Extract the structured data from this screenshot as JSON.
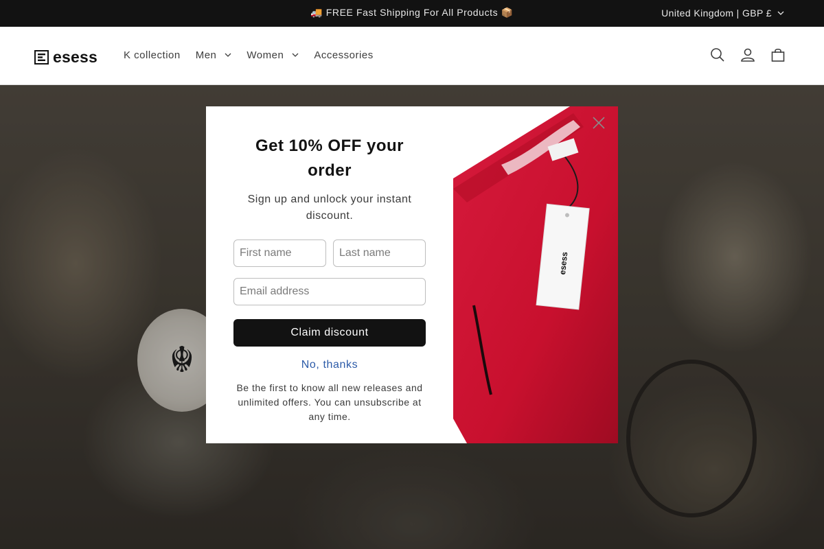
{
  "announcement": {
    "message": "🚚 FREE Fast Shipping For All Products 📦",
    "country": "United Kingdom | GBP £"
  },
  "header": {
    "logo_text": "esess",
    "nav": [
      {
        "label": "K collection",
        "has_dropdown": false
      },
      {
        "label": "Men",
        "has_dropdown": true
      },
      {
        "label": "Women",
        "has_dropdown": true
      },
      {
        "label": "Accessories",
        "has_dropdown": false
      }
    ],
    "icons": [
      "search-icon",
      "account-icon",
      "cart-icon"
    ]
  },
  "popup": {
    "title": "Get 10% OFF your order",
    "subtitle": "Sign up and unlock your instant discount.",
    "first_name_placeholder": "First name",
    "last_name_placeholder": "Last name",
    "email_placeholder": "Email address",
    "claim_label": "Claim discount",
    "decline_label": "No, thanks",
    "fine_print": "Be the first to know all new releases and unlimited offers. You can unsubscribe at any time.",
    "tag_text": "esess",
    "accent_color": "#c8102e"
  }
}
